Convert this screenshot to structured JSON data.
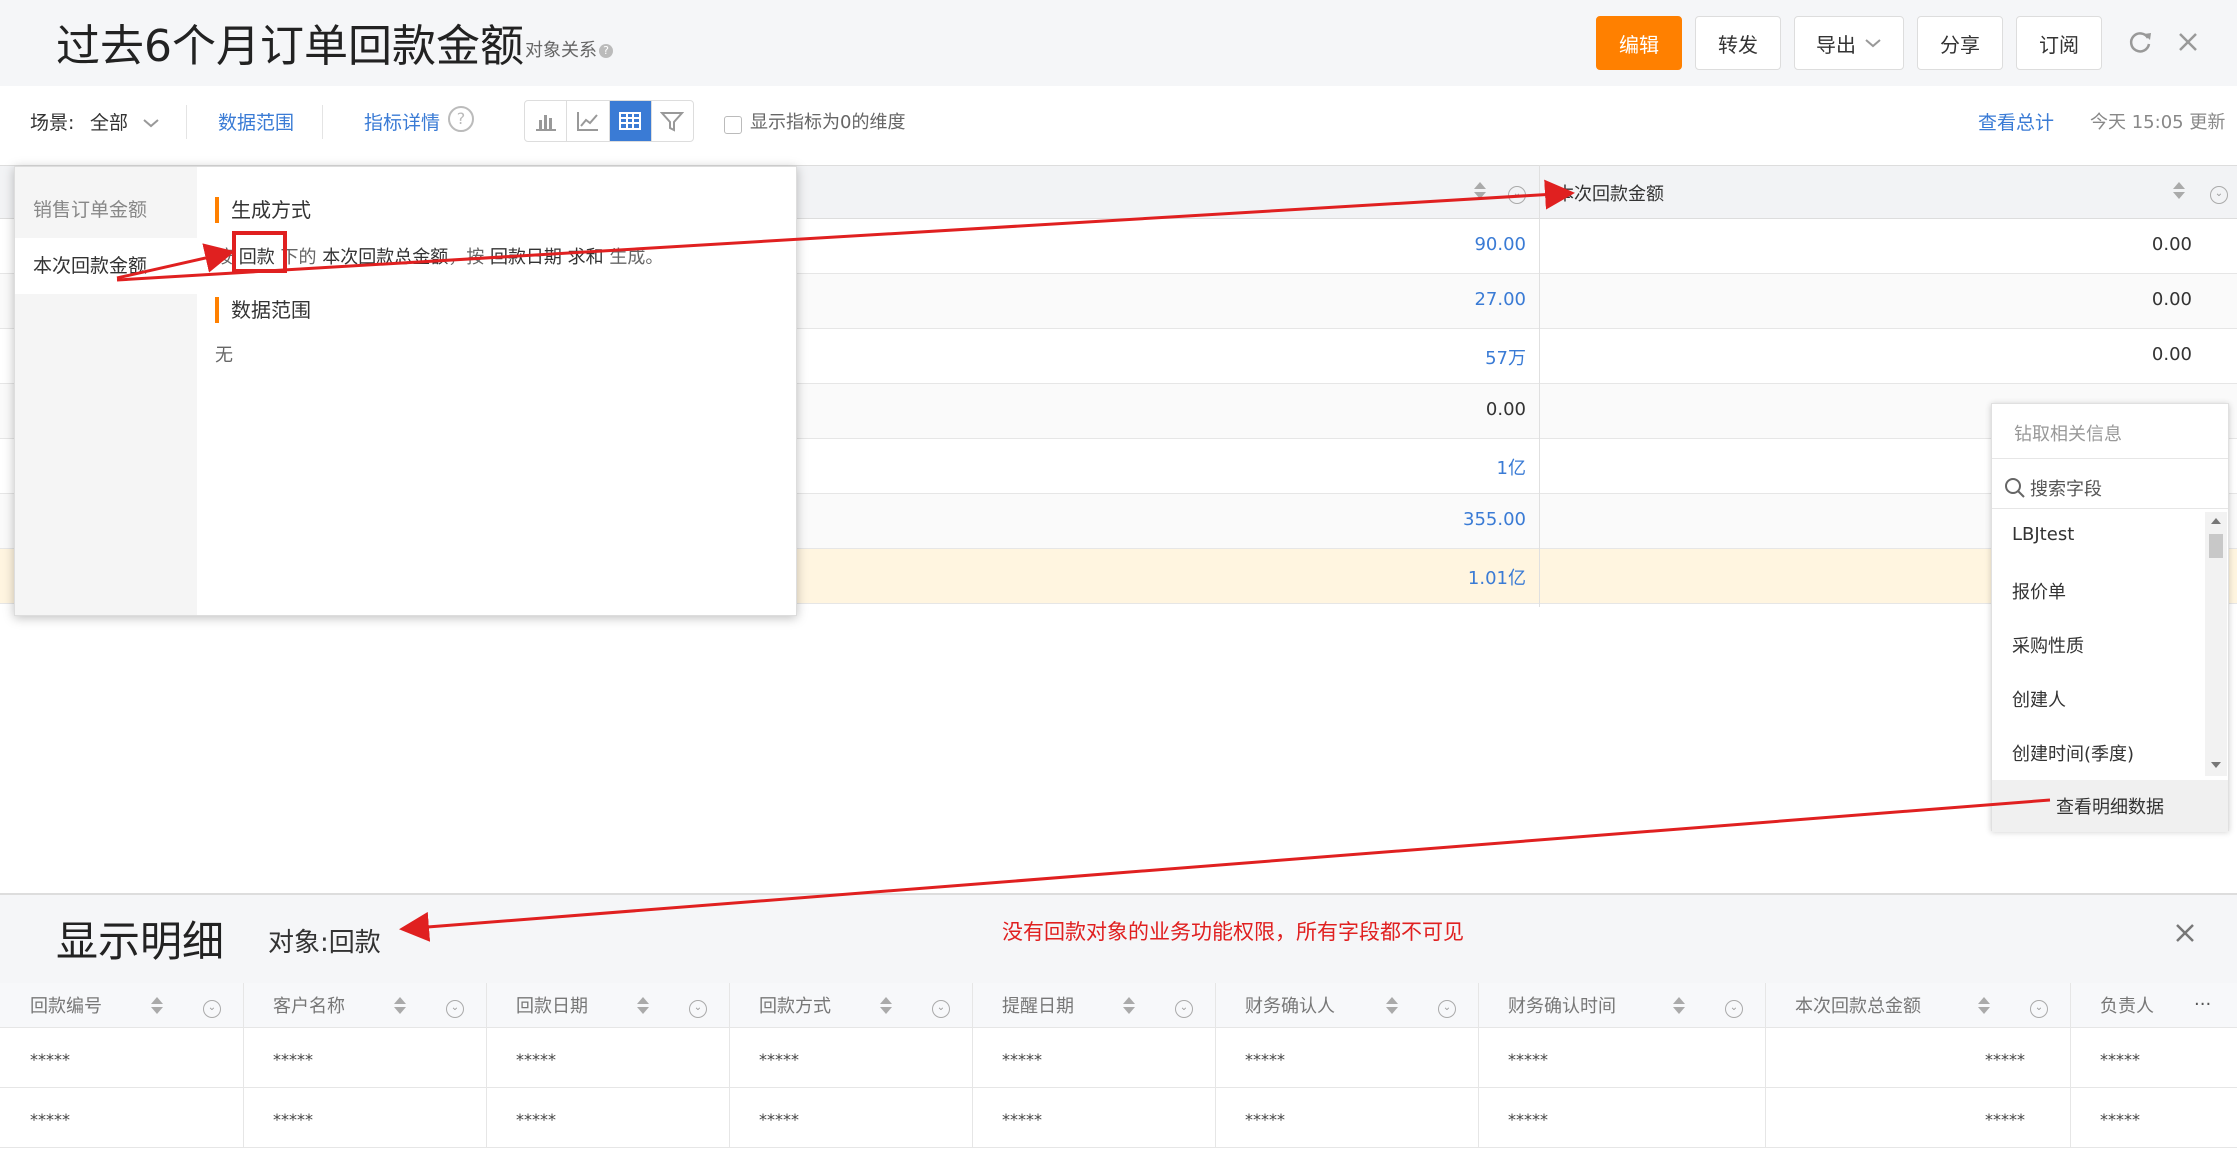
{
  "header": {
    "title": "过去6个月订单回款金额",
    "relation_link": "对象关系",
    "buttons": {
      "edit": "编辑",
      "forward": "转发",
      "export": "导出",
      "share": "分享",
      "subscribe": "订阅"
    }
  },
  "toolbar": {
    "scene_label": "场景:",
    "scene_value": "全部",
    "data_range": "数据范围",
    "metric_detail": "指标详情",
    "show_zero_label": "显示指标为0的维度",
    "view_total": "查看总计",
    "update_time": "今天 15:05 更新"
  },
  "table": {
    "col2_header": "本次回款金额",
    "rows": [
      {
        "col1": "90.00",
        "col2": "0.00",
        "link": true
      },
      {
        "col1": "27.00",
        "col2": "0.00",
        "link": true
      },
      {
        "col1": "57万",
        "col2": "0.00",
        "link": true
      },
      {
        "col1": "0.00",
        "col2": "",
        "link": false
      },
      {
        "col1": "1亿",
        "col2": "",
        "link": true
      },
      {
        "col1": "355.00",
        "col2": "",
        "link": true
      },
      {
        "col1": "1.01亿",
        "col2": "",
        "link": true
      }
    ]
  },
  "popup": {
    "side_items": [
      "销售订单金额",
      "本次回款金额"
    ],
    "section1_title": "生成方式",
    "gen_p1": "按",
    "gen_obj": "回款",
    "gen_p2": "下的",
    "gen_field": "本次回款总金额",
    "gen_p3": "，按",
    "gen_date": "回款日期",
    "gen_agg": "求和",
    "gen_p4": "生成。",
    "section2_title": "数据范围",
    "range_value": "无"
  },
  "drill": {
    "title": "钻取相关信息",
    "search_placeholder": "搜索字段",
    "items": [
      "LBJtest",
      "报价单",
      "采购性质",
      "创建人",
      "创建时间(季度)"
    ],
    "detail_button": "查看明细数据"
  },
  "detail": {
    "title": "显示明细",
    "object": "对象:回款",
    "annotation": "没有回款对象的业务功能权限，所有字段都不可见",
    "columns": [
      "回款编号",
      "客户名称",
      "回款日期",
      "回款方式",
      "提醒日期",
      "财务确认人",
      "财务确认时间",
      "本次回款总金额",
      "负责人"
    ],
    "masked": "*****",
    "more": "···"
  },
  "colors": {
    "accent": "#ff8000",
    "link": "#3a7bd5",
    "annotation": "#e02020"
  }
}
